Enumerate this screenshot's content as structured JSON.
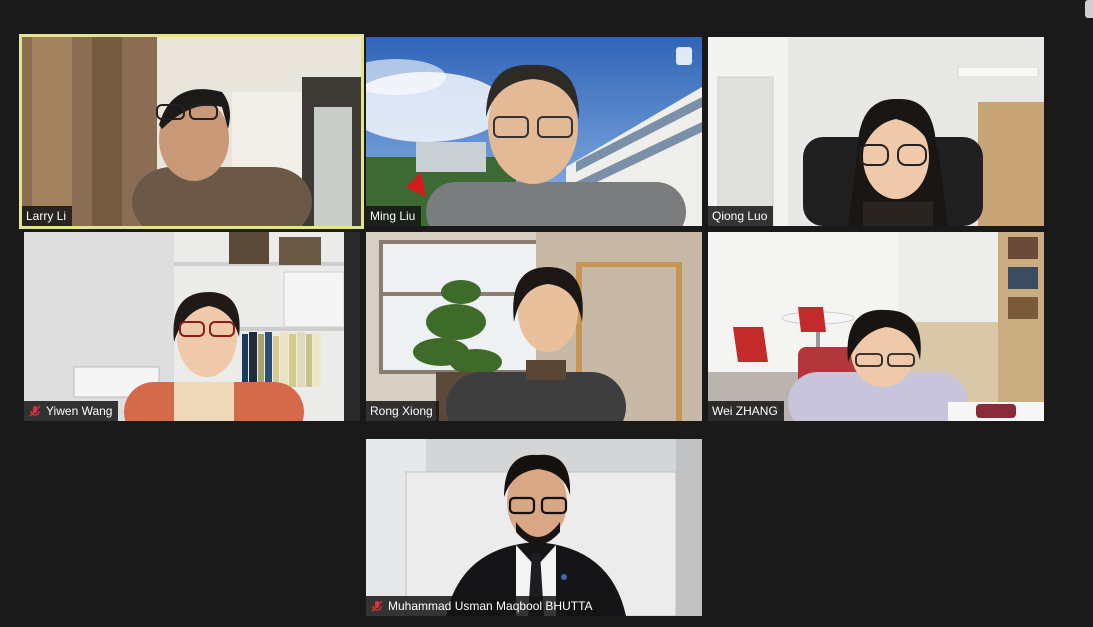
{
  "participants": [
    {
      "name": "Larry Li",
      "muted": false,
      "active_speaker": true
    },
    {
      "name": "Ming Liu",
      "muted": false,
      "active_speaker": false
    },
    {
      "name": "Qiong Luo",
      "muted": false,
      "active_speaker": false
    },
    {
      "name": "Yiwen Wang",
      "muted": true,
      "active_speaker": false
    },
    {
      "name": "Rong Xiong",
      "muted": false,
      "active_speaker": false
    },
    {
      "name": "Wei ZHANG",
      "muted": false,
      "active_speaker": false
    },
    {
      "name": "Muhammad Usman Maqbool BHUTTA",
      "muted": true,
      "active_speaker": false
    }
  ],
  "colors": {
    "background": "#1a1a1a",
    "active_border": "#e2e58a",
    "mute_icon": "#e0303a"
  },
  "icons": {
    "mute": "microphone-muted-icon",
    "menu": "more-options-icon"
  }
}
